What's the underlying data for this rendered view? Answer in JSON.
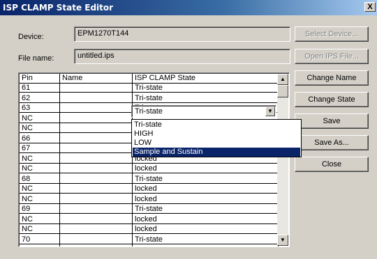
{
  "window": {
    "title": "ISP CLAMP State Editor",
    "close_glyph": "X"
  },
  "device": {
    "label": "Device:",
    "value": "EPM1270T144"
  },
  "file": {
    "label": "File name:",
    "value": "untitled.ips"
  },
  "buttons": {
    "select_device": "Select Device...",
    "open_ips": "Open IPS File...",
    "change_name": "Change Name",
    "change_state": "Change State",
    "save": "Save",
    "save_as": "Save As...",
    "close": "Close"
  },
  "table": {
    "headers": [
      "Pin",
      "Name",
      "ISP CLAMP State"
    ],
    "rows": [
      {
        "pin": "61",
        "name": "",
        "state": "Tri-state"
      },
      {
        "pin": "62",
        "name": "",
        "state": "Tri-state"
      },
      {
        "pin": "63",
        "name": "",
        "state": "Tri-state"
      },
      {
        "pin": "NC",
        "name": "",
        "state": ""
      },
      {
        "pin": "NC",
        "name": "",
        "state": ""
      },
      {
        "pin": "66",
        "name": "",
        "state": ""
      },
      {
        "pin": "67",
        "name": "",
        "state": ""
      },
      {
        "pin": "NC",
        "name": "",
        "state": "locked"
      },
      {
        "pin": "NC",
        "name": "",
        "state": "locked"
      },
      {
        "pin": "68",
        "name": "",
        "state": "Tri-state"
      },
      {
        "pin": "NC",
        "name": "",
        "state": "locked"
      },
      {
        "pin": "NC",
        "name": "",
        "state": "locked"
      },
      {
        "pin": "69",
        "name": "",
        "state": "Tri-state"
      },
      {
        "pin": "NC",
        "name": "",
        "state": "locked"
      },
      {
        "pin": "NC",
        "name": "",
        "state": "locked"
      },
      {
        "pin": "70",
        "name": "",
        "state": "Tri-state"
      }
    ]
  },
  "combo": {
    "value": "Tri-state"
  },
  "dropdown": {
    "options": [
      "Tri-state",
      "HIGH",
      "LOW",
      "Sample and Sustain"
    ],
    "selected": "Sample and Sustain"
  },
  "colors": {
    "selection": "#0a246a",
    "face": "#d4d0c8"
  }
}
